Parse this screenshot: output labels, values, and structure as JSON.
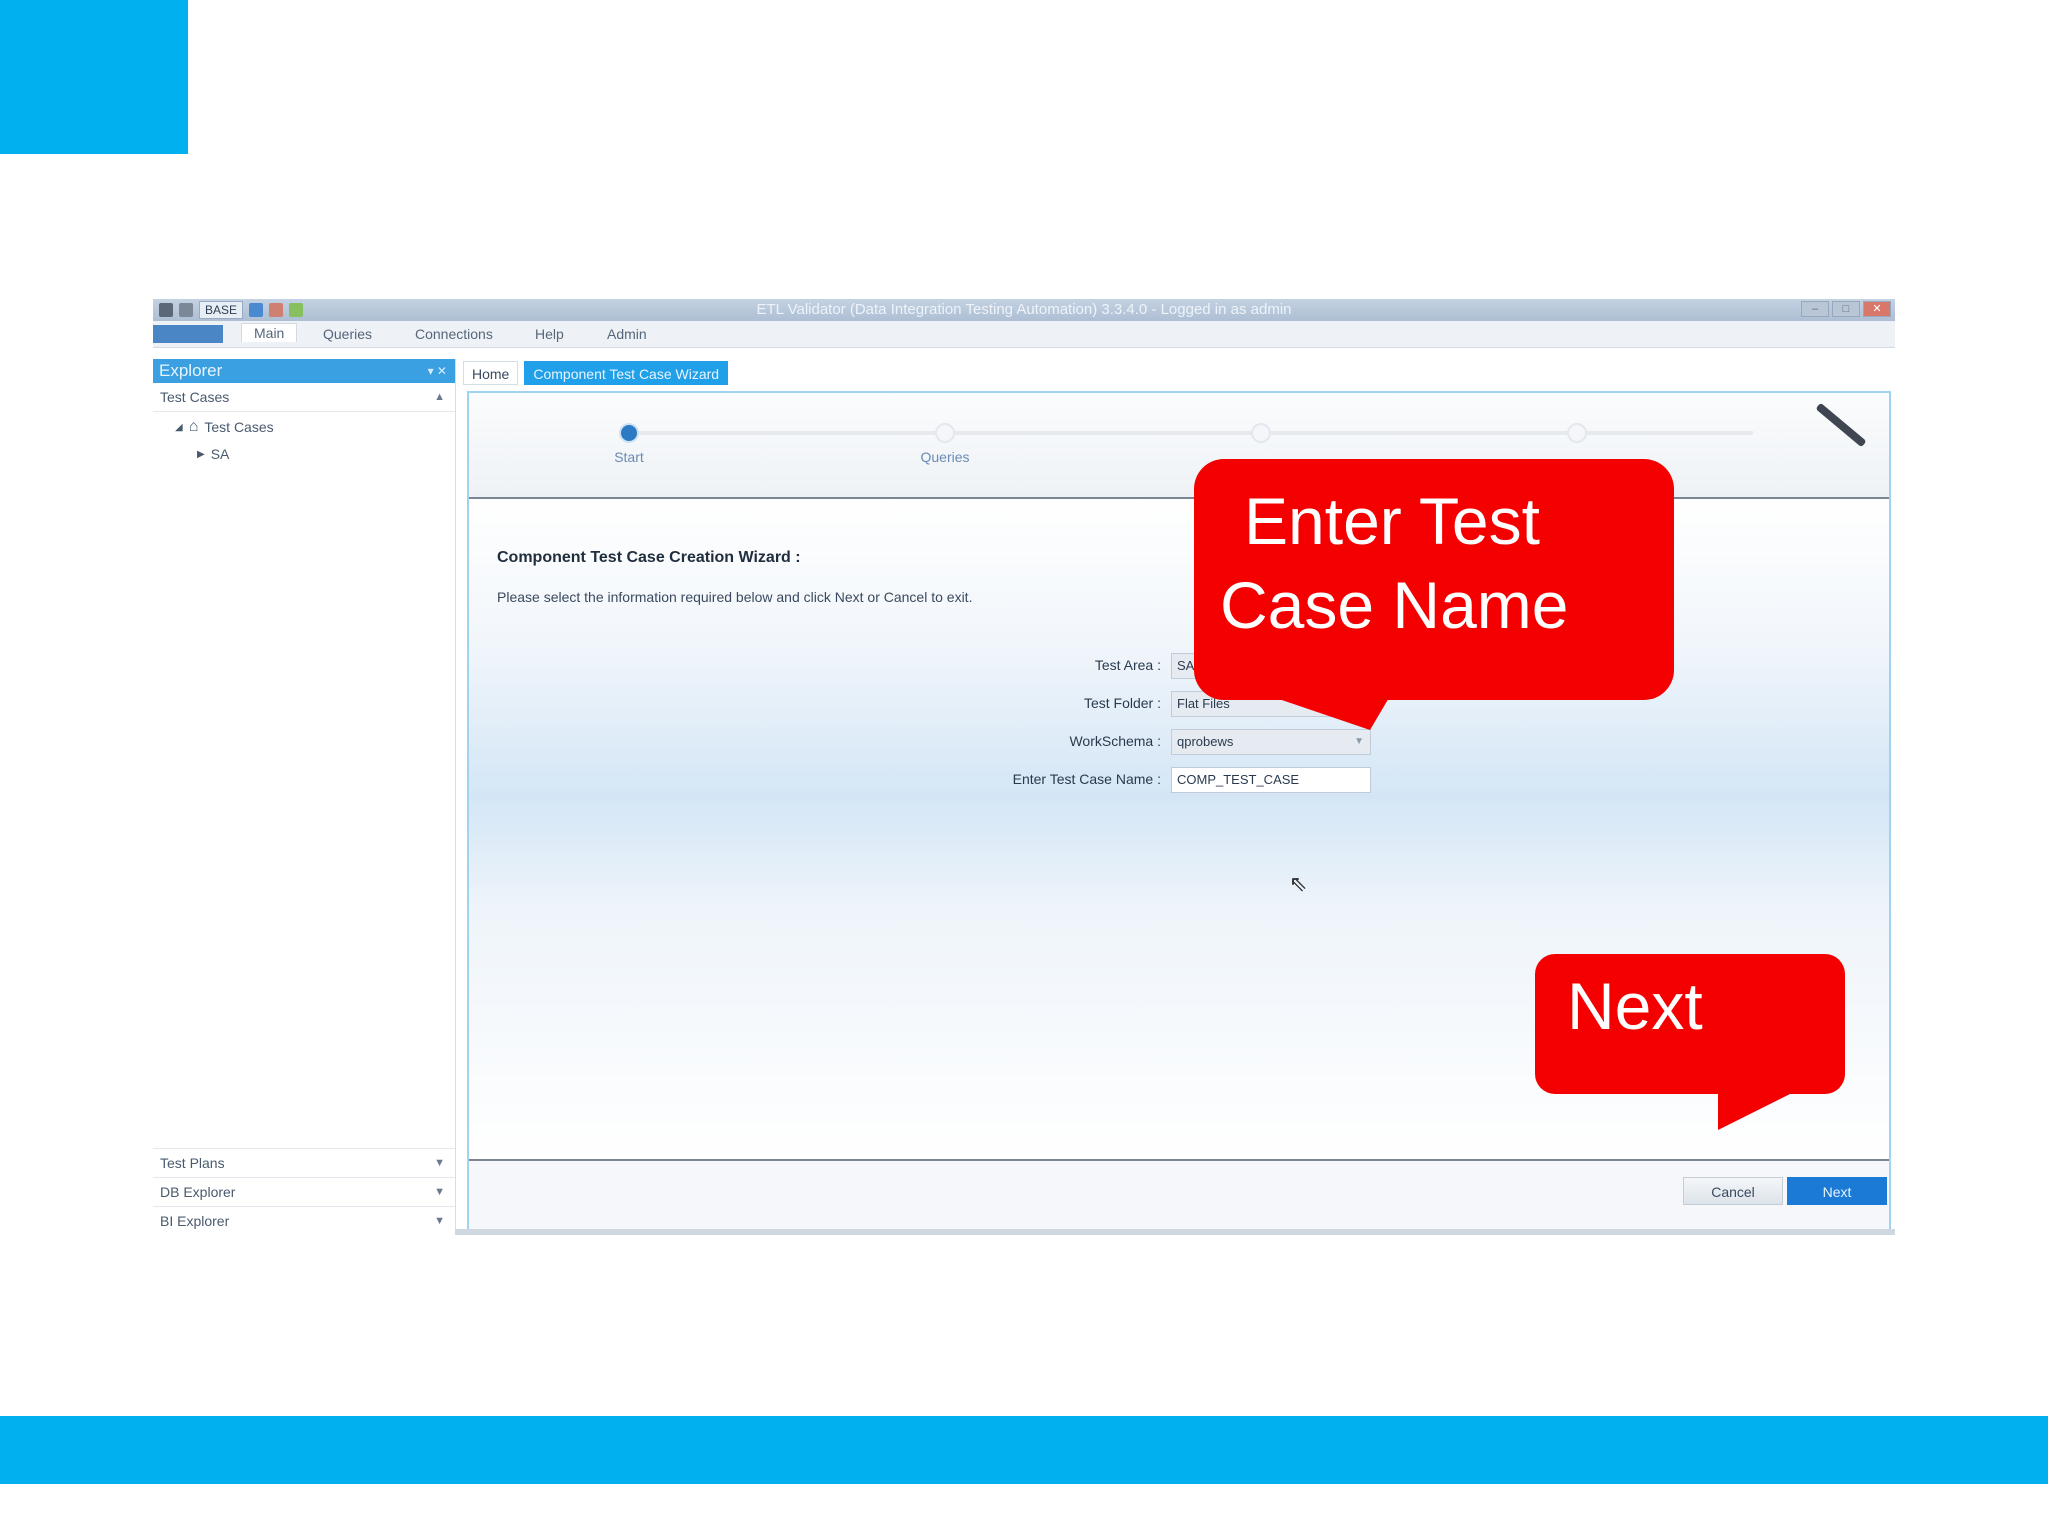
{
  "titlebar": {
    "title": "ETL Validator (Data Integration Testing Automation) 3.3.4.0 - Logged in as admin",
    "base_selector": "BASE"
  },
  "ribbon": {
    "tabs": [
      "Main",
      "Queries",
      "Connections",
      "Help",
      "Admin"
    ]
  },
  "explorer": {
    "title": "Explorer",
    "section": "Test Cases",
    "tree": [
      "Test Cases",
      "SA"
    ],
    "bottom_sections": [
      "Test Plans",
      "DB Explorer",
      "BI Explorer"
    ]
  },
  "doc_tabs": [
    "Home",
    "Component Test Case Wizard"
  ],
  "wizard": {
    "steps": [
      "Start",
      "Queries"
    ],
    "heading": "Component Test Case Creation Wizard :",
    "subtext": "Please select the information required below and click Next or Cancel to exit.",
    "fields": [
      {
        "label": "Test Area :",
        "value": "SA"
      },
      {
        "label": "Test Folder :",
        "value": "Flat Files"
      },
      {
        "label": "WorkSchema :",
        "value": "qprobews"
      },
      {
        "label": "Enter Test Case Name :",
        "value": "COMP_TEST_CASE"
      }
    ],
    "cancel_label": "Cancel",
    "next_label": "Next"
  },
  "callouts": {
    "first_line1": "Enter Test",
    "first_line2": "Case Name",
    "second": "Next"
  },
  "colors": {
    "slide_accent": "#00b0ef",
    "callout": "#f40000",
    "primary_button": "#1a7ad6"
  }
}
